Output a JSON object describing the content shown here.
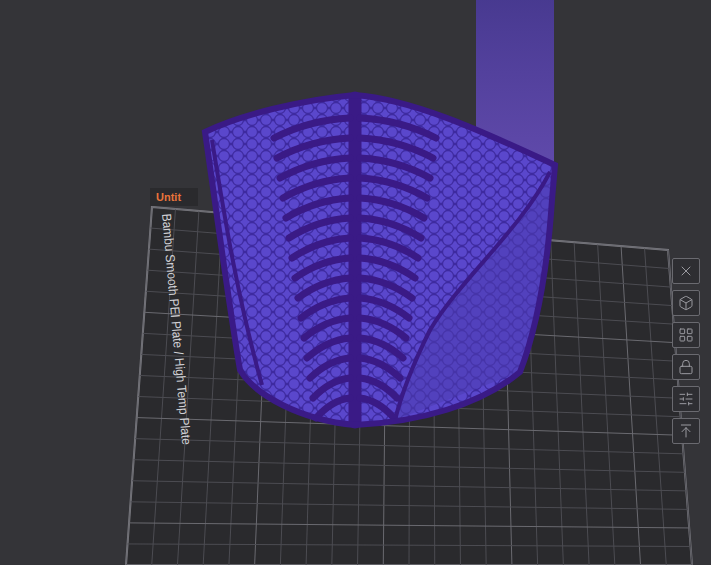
{
  "plate_tab": {
    "label": "Untit"
  },
  "plate": {
    "label": "Bambu Smooth PEI Plate / High Temp Plate"
  }
}
